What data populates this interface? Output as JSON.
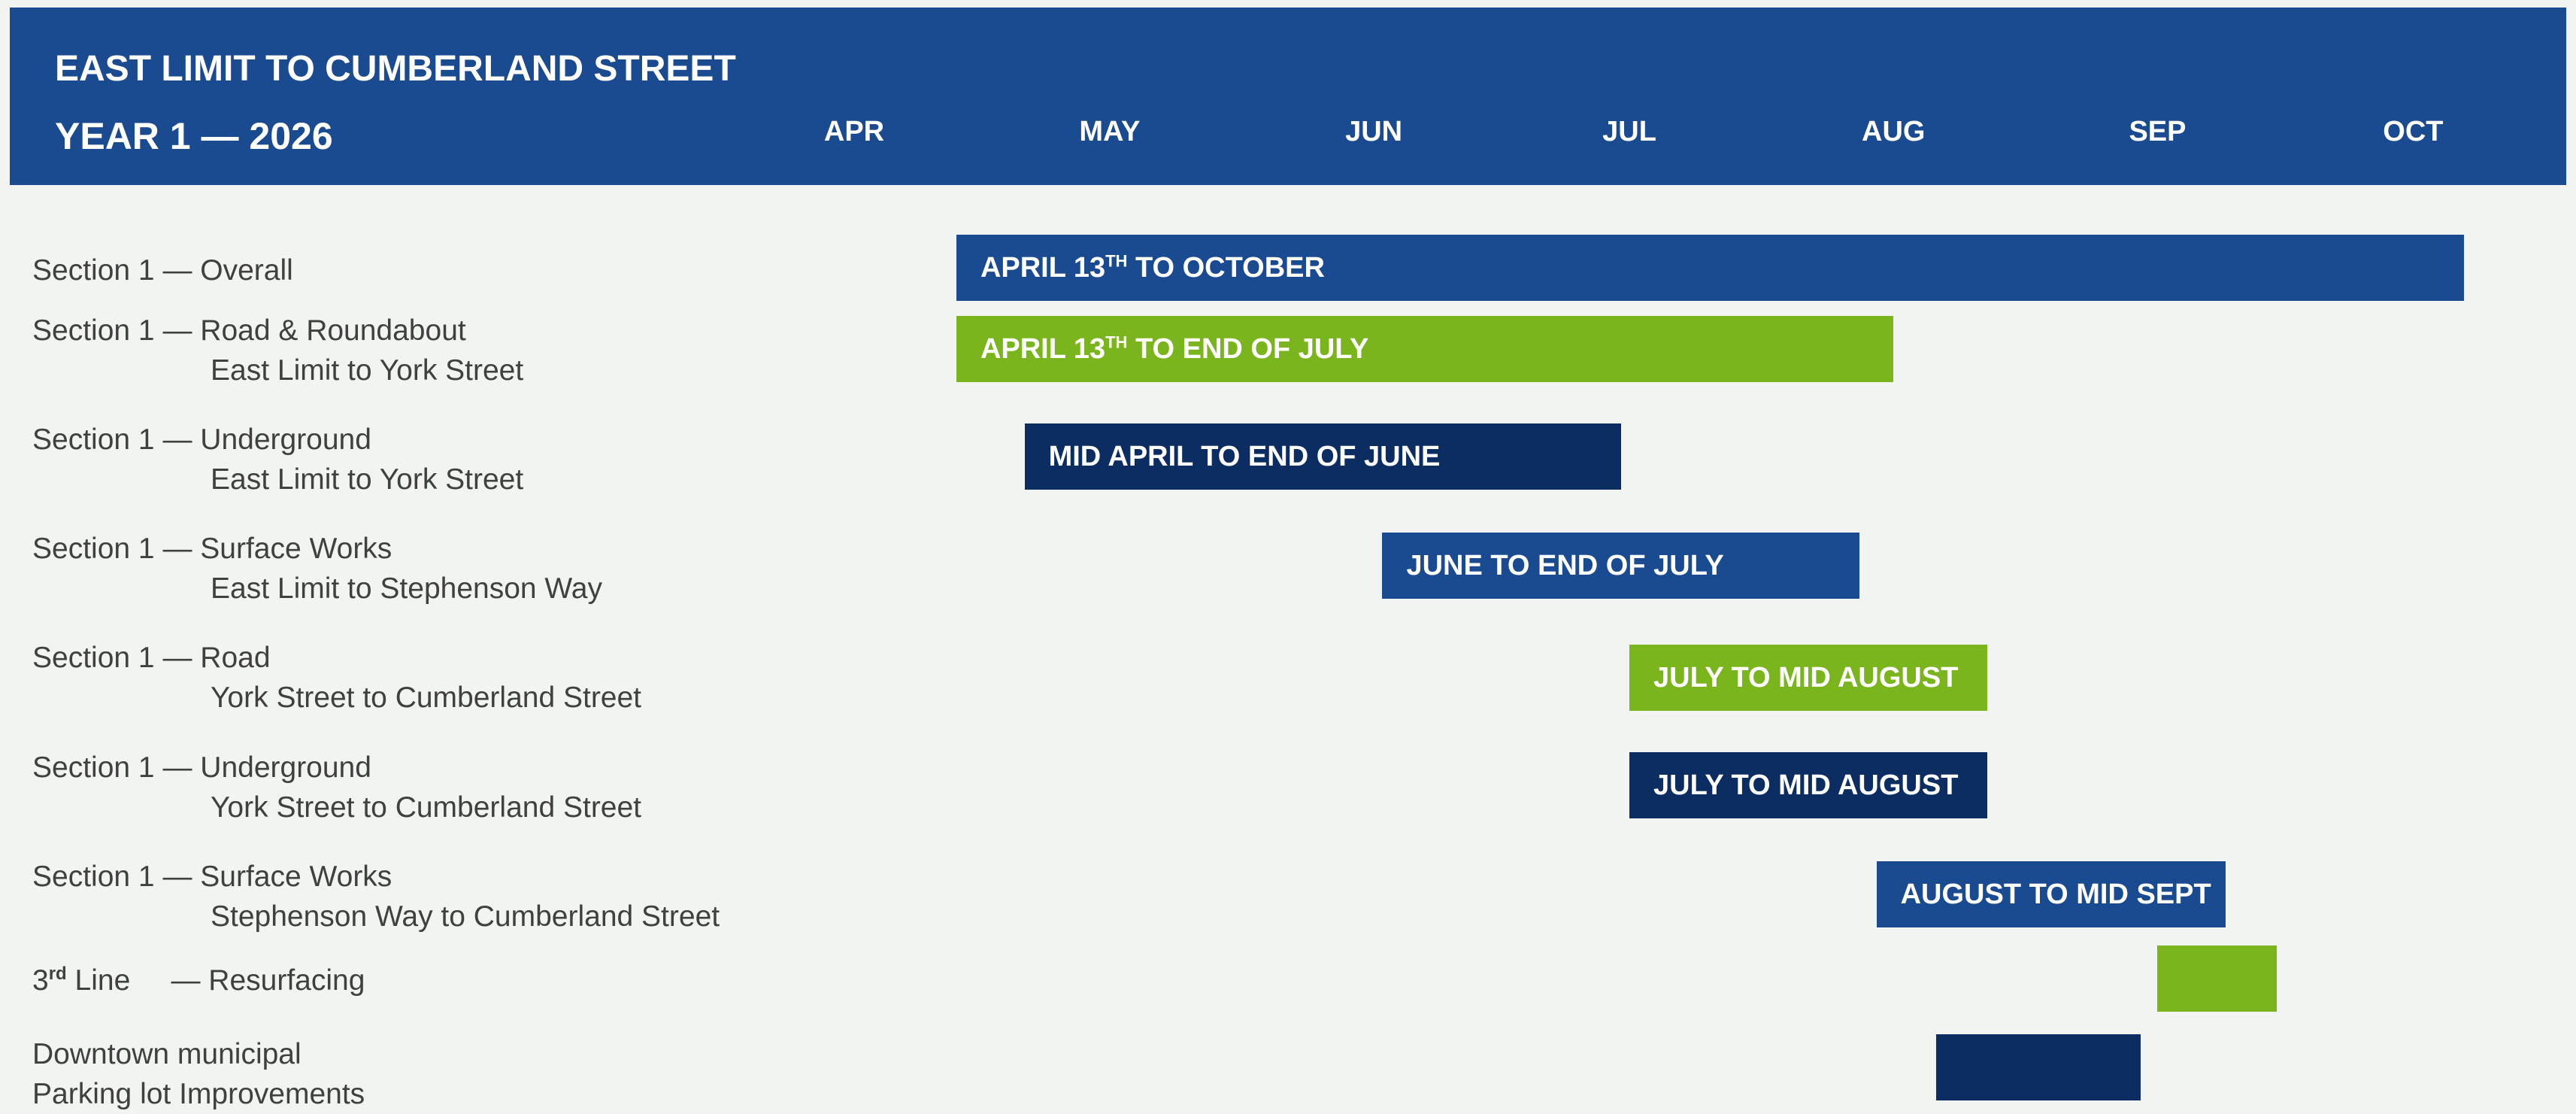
{
  "header": {
    "title_line1": "EAST LIMIT TO CUMBERLAND STREET",
    "title_line2": "YEAR 1 — 2026"
  },
  "colors": {
    "header_blue": "#1a4a8f",
    "bar_blue": "#1a4a8f",
    "bar_green": "#7ab51d",
    "bar_navy": "#0c2d62",
    "background": "#f1f4f0",
    "label_text": "#404040"
  },
  "chart_data": {
    "type": "gantt",
    "months": [
      "APR",
      "MAY",
      "JUN",
      "JUL",
      "AUG",
      "SEP",
      "OCT"
    ],
    "tasks": [
      {
        "label": "Section 1 — Overall",
        "sublabel": "",
        "bar_label": "APRIL 13",
        "bar_label_sup": "TH",
        "bar_label_rest": " TO OCTOBER",
        "start": "2026-04-13",
        "end": "2026-10-07",
        "color": "#1a4a8f"
      },
      {
        "label": "Section 1 — Road & Roundabout",
        "sublabel": "East Limit to York Street",
        "bar_label": "APRIL 13",
        "bar_label_sup": "TH",
        "bar_label_rest": " TO END OF JULY",
        "start": "2026-04-13",
        "end": "2026-08-01",
        "color": "#7ab51d"
      },
      {
        "label": "Section 1 — Underground",
        "sublabel": "East Limit to York Street",
        "bar_label": "MID APRIL TO END OF JUNE",
        "start": "2026-04-21",
        "end": "2026-06-30",
        "color": "#0c2d62"
      },
      {
        "label": "Section 1 — Surface Works",
        "sublabel": "East Limit to Stephenson Way",
        "bar_label": "JUNE TO END OF JULY",
        "start": "2026-06-02",
        "end": "2026-07-28",
        "color": "#1a4a8f"
      },
      {
        "label": "Section 1 — Road",
        "sublabel": "York Street to Cumberland Street",
        "bar_label": "JULY TO MID AUGUST",
        "start": "2026-07-01",
        "end": "2026-08-12",
        "color": "#7ab51d"
      },
      {
        "label": "Section 1 — Underground",
        "sublabel": "York Street to Cumberland Street",
        "bar_label": "JULY TO MID AUGUST",
        "start": "2026-07-01",
        "end": "2026-08-12",
        "color": "#0c2d62"
      },
      {
        "label": "Section 1 — Surface Works",
        "sublabel": "Stephenson Way to Cumberland Street",
        "bar_label": "AUGUST TO MID SEPT",
        "start": "2026-07-30",
        "end": "2026-09-09",
        "color": "#1a4a8f"
      },
      {
        "label": "3",
        "label_sup": "rd",
        "label_rest": " Line     — Resurfacing",
        "sublabel": "",
        "bar_label": "",
        "start": "2026-09-01",
        "end": "2026-09-15",
        "color": "#7ab51d"
      },
      {
        "label": "Downtown municipal",
        "label_line2": "Parking lot Improvements",
        "sublabel": "",
        "bar_label": "",
        "start": "2026-08-06",
        "end": "2026-08-30",
        "color": "#0c2d62"
      }
    ]
  }
}
